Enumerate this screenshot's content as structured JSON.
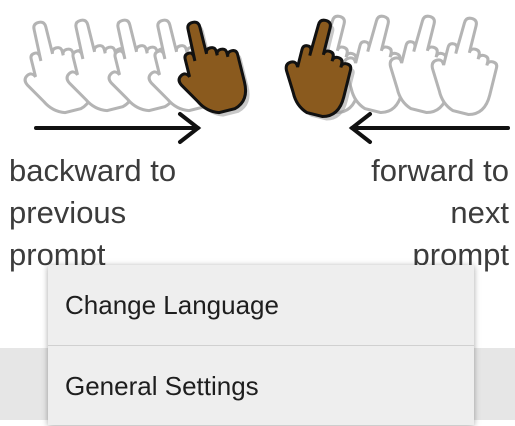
{
  "illustration": {
    "hand_active_color": "#8a5a1e",
    "hand_ghost_color": "#b4b4b4",
    "arrow_color": "#111111"
  },
  "hints": {
    "backward": [
      "backward to",
      "previous",
      "prompt"
    ],
    "forward": [
      "forward to",
      "next",
      "prompt"
    ]
  },
  "menu": {
    "items": [
      {
        "label": "Change Language"
      },
      {
        "label": "General Settings"
      }
    ]
  }
}
